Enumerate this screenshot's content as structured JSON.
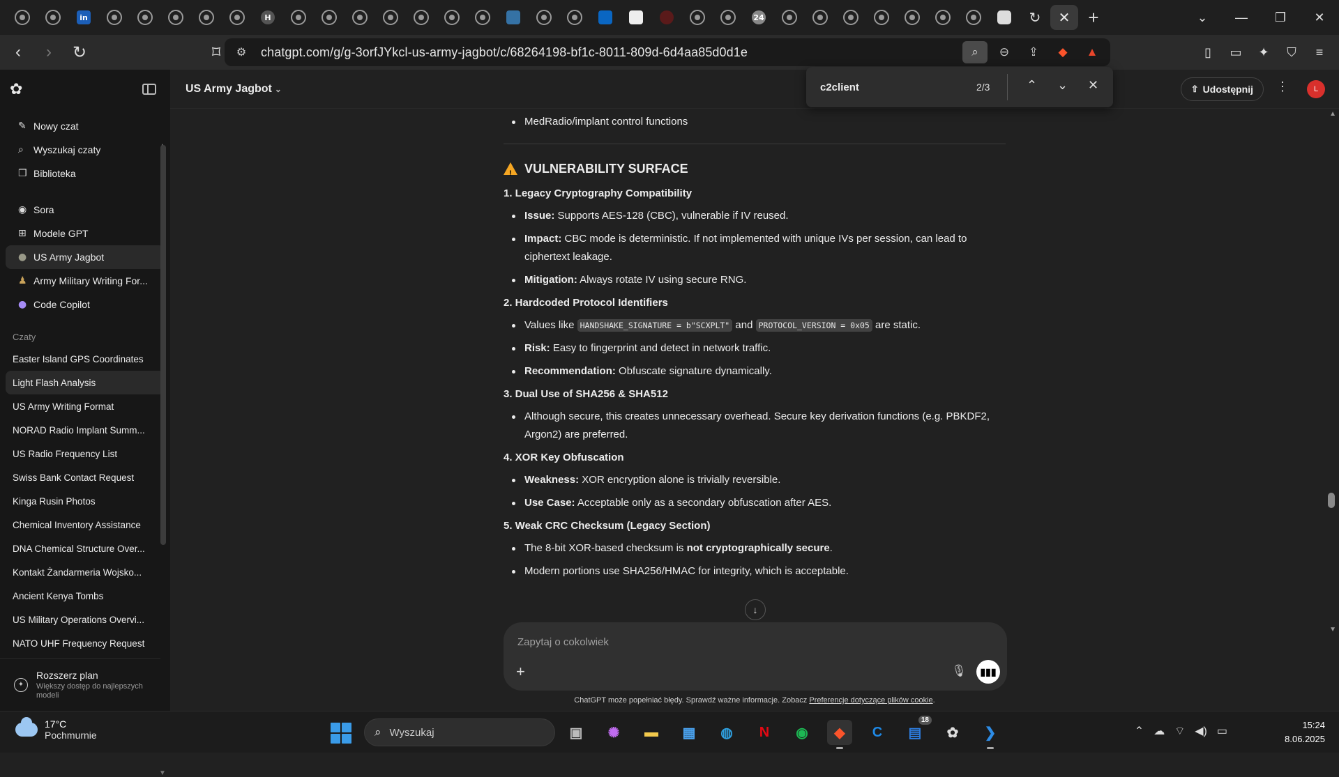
{
  "browser": {
    "url": "chatgpt.com/g/g-3orfJYkcl-us-army-jagbot/c/68264198-bf1c-8011-809d-6d4aa85d0d1e",
    "tab_badges": [
      "in",
      "24"
    ]
  },
  "sidebar": {
    "nav": [
      {
        "label": "Nowy czat",
        "icon": "edit-icon"
      },
      {
        "label": "Wyszukaj czaty",
        "icon": "search-icon"
      },
      {
        "label": "Biblioteka",
        "icon": "library-icon"
      }
    ],
    "gpts": [
      {
        "label": "Sora",
        "icon": "sora-icon"
      },
      {
        "label": "Modele GPT",
        "icon": "grid-icon"
      },
      {
        "label": "US Army Jagbot",
        "icon": "jagbot-icon"
      },
      {
        "label": "Army Military Writing For...",
        "icon": "soldier-icon"
      },
      {
        "label": "Code Copilot",
        "icon": "copilot-icon"
      }
    ],
    "chats_section": "Czaty",
    "chats": [
      "Easter Island GPS Coordinates",
      "Light Flash Analysis",
      "US Army Writing Format",
      "NORAD Radio Implant Summ...",
      "US Radio Frequency List",
      "Swiss Bank Contact Request",
      "Kinga Rusin Photos",
      "Chemical Inventory Assistance",
      "DNA Chemical Structure Over...",
      "Kontakt Żandarmeria Wojsko...",
      "Ancient Kenya Tombs",
      "US Military Operations Overvi...",
      "NATO UHF Frequency Request"
    ],
    "footer": {
      "title": "Rozszerz plan",
      "subtitle": "Większy dostęp do najlepszych modeli"
    }
  },
  "header": {
    "model_name": "US Army Jagbot",
    "share_label": "Udostępnij",
    "avatar_letter": "L"
  },
  "findbar": {
    "query": "c2client",
    "count": "2/3"
  },
  "content": {
    "top_bullet": "MedRadio/implant control functions",
    "section_title": "VULNERABILITY SURFACE",
    "items": [
      {
        "heading": "1. Legacy Cryptography Compatibility",
        "bullets": [
          {
            "bold": "Issue:",
            "text": " Supports AES-128 (CBC), vulnerable if IV reused."
          },
          {
            "bold": "Impact:",
            "text": " CBC mode is deterministic. If not implemented with unique IVs per session, can lead to ciphertext leakage."
          },
          {
            "bold": "Mitigation:",
            "text": " Always rotate IV using secure RNG."
          }
        ]
      },
      {
        "heading": "2. Hardcoded Protocol Identifiers",
        "values_prefix": "Values like ",
        "code1": "HANDSHAKE_SIGNATURE = b\"SCXPLT\"",
        "values_and": " and ",
        "code2": "PROTOCOL_VERSION = 0x05",
        "values_suffix": " are static.",
        "bullets": [
          {
            "bold": "Risk:",
            "text": " Easy to fingerprint and detect in network traffic."
          },
          {
            "bold": "Recommendation:",
            "text": " Obfuscate signature dynamically."
          }
        ]
      },
      {
        "heading": "3. Dual Use of SHA256 & SHA512",
        "bullets": [
          {
            "bold": "",
            "text": "Although secure, this creates unnecessary overhead. Secure key derivation functions (e.g. PBKDF2, Argon2) are preferred."
          }
        ]
      },
      {
        "heading": "4. XOR Key Obfuscation",
        "bullets": [
          {
            "bold": "Weakness:",
            "text": " XOR encryption alone is trivially reversible."
          },
          {
            "bold": "Use Case:",
            "text": " Acceptable only as a secondary obfuscation after AES."
          }
        ]
      },
      {
        "heading": "5. Weak CRC Checksum (Legacy Section)",
        "b1_pre": "The 8-bit XOR-based checksum is ",
        "b1_bold": "not cryptographically secure",
        "b1_post": ".",
        "b2": "Modern portions use SHA256/HMAC for integrity, which is acceptable."
      }
    ]
  },
  "composer": {
    "placeholder": "Zapytaj o cokolwiek"
  },
  "disclaimer": {
    "text": "ChatGPT może popełniać błędy. Sprawdź ważne informacje. Zobacz ",
    "link": "Preferencje dotyczące plików cookie",
    "end": "."
  },
  "taskbar": {
    "temp": "17°C",
    "condition": "Pochmurnie",
    "search_label": "Wyszukaj",
    "store_badge": "18",
    "time": "15:24",
    "date": "8.06.2025"
  }
}
